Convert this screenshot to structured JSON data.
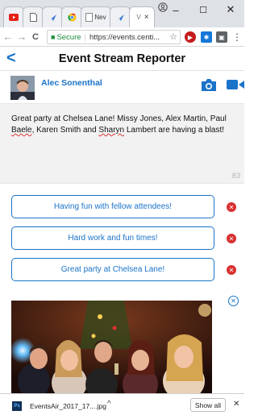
{
  "browser": {
    "tabs": [
      {
        "icon": "youtube-icon",
        "label": ""
      },
      {
        "icon": "document-icon",
        "label": ""
      },
      {
        "icon": "bird-icon",
        "label": ""
      },
      {
        "icon": "chrome-icon",
        "label": ""
      },
      {
        "icon": "new-tab-icon",
        "label": "Nev"
      },
      {
        "icon": "bird-icon",
        "label": ""
      },
      {
        "icon": "app-icon",
        "label": "V",
        "active": true,
        "close": "×"
      }
    ],
    "window_controls": {
      "minimize": "–",
      "maximize": "☐",
      "close": "✕"
    },
    "nav": {
      "back": "←",
      "forward": "→",
      "reload": "C"
    },
    "address": {
      "secure_label": "Secure",
      "url": "https://events.centi..."
    }
  },
  "app": {
    "header": {
      "back": "<",
      "title": "Event Stream Reporter"
    },
    "user": {
      "name": "Alec Sonenthal"
    },
    "post": {
      "text_parts": [
        "Great party at Chelsea Lane! Missy Jones, Alex Martin, Paul ",
        "Baele",
        ", Karen Smith and ",
        "Sharyn",
        " Lambert are having a blast!"
      ],
      "char_counter": "83"
    },
    "suggestions": [
      {
        "label": "Having fun with fellow attendees!"
      },
      {
        "label": "Hard work and fun times!"
      },
      {
        "label": "Great party at Chelsea Lane!"
      }
    ],
    "remove_glyph": "✕"
  },
  "downloads": {
    "file_name": "EventsAir_2017_17....jpg",
    "caret": "^",
    "show_all": "Show all",
    "close": "✕"
  },
  "colors": {
    "accent": "#1a73c8",
    "remove": "#d93030",
    "secure": "#1e8e3e"
  }
}
